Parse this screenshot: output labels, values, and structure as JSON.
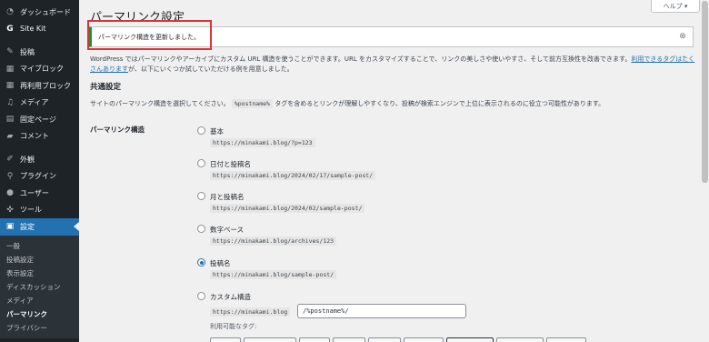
{
  "sidebar": {
    "items": [
      {
        "label": "ダッシュボード",
        "icon": "dashboard-icon"
      },
      {
        "label": "Site Kit",
        "icon": "sitekit-icon"
      },
      {
        "label": "投稿",
        "icon": "pin-icon"
      },
      {
        "label": "マイブロック",
        "icon": "block-icon"
      },
      {
        "label": "再利用ブロック",
        "icon": "reusable-block-icon"
      },
      {
        "label": "メディア",
        "icon": "media-icon"
      },
      {
        "label": "固定ページ",
        "icon": "page-icon"
      },
      {
        "label": "コメント",
        "icon": "comment-icon"
      },
      {
        "label": "外観",
        "icon": "brush-icon"
      },
      {
        "label": "プラグイン",
        "icon": "plugin-icon"
      },
      {
        "label": "ユーザー",
        "icon": "user-icon"
      },
      {
        "label": "ツール",
        "icon": "wrench-icon"
      },
      {
        "label": "設定",
        "icon": "settings-icon"
      }
    ],
    "submenu": [
      "一般",
      "投稿設定",
      "表示設定",
      "ディスカッション",
      "メディア",
      "パーマリンク",
      "プライバシー"
    ]
  },
  "header": {
    "help_label": "ヘルプ ▾",
    "title": "パーマリンク設定"
  },
  "notice": {
    "text": "パーマリンク構造を更新しました。",
    "close": "⊗"
  },
  "intro": {
    "text_a": "WordPress ではパーマリンクやアーカイブにカスタム URL 構造を使うことができます。URL をカスタマイズすることで、リンクの美しさや使いやすさ、そして前方互換性を改善できます。",
    "link": "利用できるタグはたくさんあります",
    "text_b": "が、以下にいくつか試していただける例を用意しました。"
  },
  "common": {
    "title": "共通設定",
    "desc_a": "サイトのパーマリンク構造を選択してください。",
    "desc_code": "%postname%",
    "desc_b": " タグを含めるとリンクが理解しやすくなり、投稿が検索エンジンで上位に表示されるのに役立つ可能性があります。",
    "field_label": "パーマリンク構造"
  },
  "options": [
    {
      "label": "基本",
      "url": "https://minakami.blog/?p=123",
      "checked": false
    },
    {
      "label": "日付と投稿名",
      "url": "https://minakami.blog/2024/02/17/sample-post/",
      "checked": false
    },
    {
      "label": "月と投稿名",
      "url": "https://minakami.blog/2024/02/sample-post/",
      "checked": false
    },
    {
      "label": "数字ベース",
      "url": "https://minakami.blog/archives/123",
      "checked": false
    },
    {
      "label": "投稿名",
      "url": "https://minakami.blog/sample-post/",
      "checked": true
    },
    {
      "label": "カスタム構造",
      "url": "https://minakami.blog",
      "checked": false
    }
  ],
  "custom": {
    "value": "/%postname%/",
    "tags_label": "利用可能なタグ:"
  },
  "colors": {
    "accent": "#2271b1",
    "success": "#00a32a",
    "highlight": "#d63638",
    "sidebar_bg": "#1d2327"
  }
}
